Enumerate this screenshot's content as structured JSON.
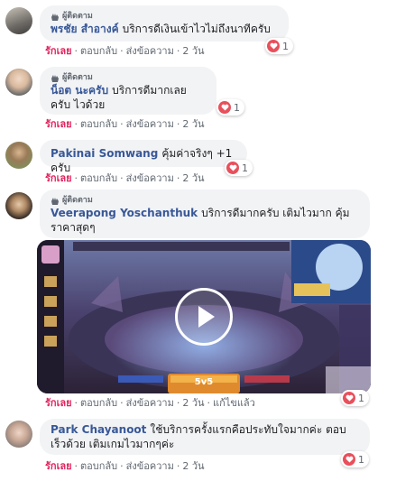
{
  "follower_label": "ผู้ติดตาม",
  "actions": {
    "like": "รักเลย",
    "reply": "ตอบกลับ",
    "share": "ส่งข้อความ",
    "time": "2 วัน",
    "edited": "แก้ไขแล้ว",
    "sep": "·"
  },
  "comments": [
    {
      "author": "พรชัย สำอางค์",
      "text": "บริการดีเงินเข้าไวไม่ถึงนาทีครับ",
      "reactions": "1",
      "follower": true
    },
    {
      "author": "น็อต นะครับ",
      "text": "บริการดีมากเลยครับ ไวด้วย",
      "reactions": "1",
      "follower": true
    },
    {
      "author": "Pakinai Somwang",
      "text": "คุ้มค่าจริงๆ +1 ครับ",
      "reactions": "1",
      "follower": false
    },
    {
      "author": "Veerapong Yoschanthuk",
      "text": "บริการดีมากครับ เติมไวมาก คุ้มราคาสุดๆ",
      "reactions": "1",
      "follower": true,
      "video": {
        "badge": "5v5"
      }
    },
    {
      "author": "Park Chayanoot",
      "text": "ใช้บริการครั้งแรกคือประทับใจมากค่ะ ตอบเร็วด้วย เติมเกมไวมากๆค่ะ",
      "reactions": "1",
      "follower": false
    }
  ],
  "colors": {
    "author": "#385898",
    "like": "#e0245e",
    "bubble": "#f2f3f5",
    "heart": "#e8505b"
  }
}
